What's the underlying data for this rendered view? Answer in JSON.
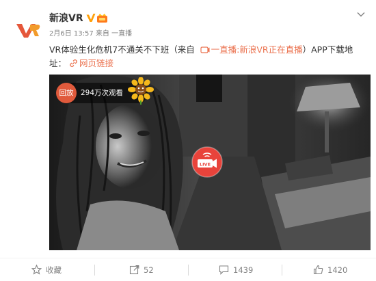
{
  "post": {
    "user": {
      "name": "新浪VR",
      "logo_text": "VR"
    },
    "meta": {
      "date": "2月6日",
      "time": "13:57",
      "source": "来自 一直播"
    },
    "content": {
      "text_prefix": "VR体验生化危机7不通关不下班（来自 ",
      "source_link": "一直播:新浪VR正在直播",
      "text_suffix": "）APP下载地",
      "line2_prefix": "址：",
      "web_link_label": "网页链接"
    },
    "video": {
      "replay_label": "回放",
      "views_text": "294万次观看"
    },
    "actions": {
      "favorite_label": "收藏",
      "repost_count": "52",
      "comment_count": "1439",
      "like_count": "1420"
    }
  },
  "colors": {
    "link": "#eb7350",
    "verified": "#ffa00a",
    "brand": "#e5573a",
    "muted": "#808080",
    "replay": "#e05a3c"
  }
}
